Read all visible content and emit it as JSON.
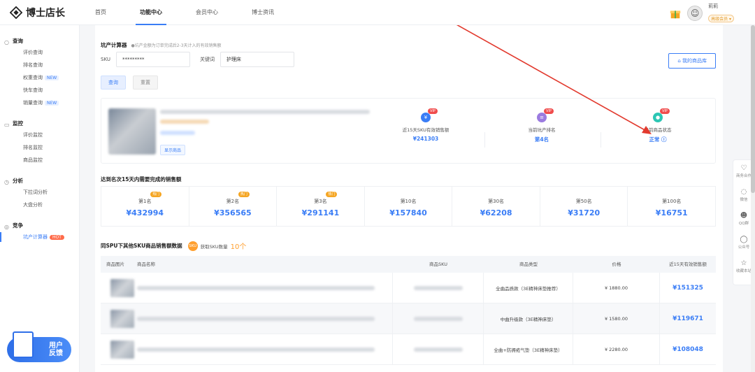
{
  "app": {
    "logo_text": "博士店长"
  },
  "nav": {
    "items": [
      "首页",
      "功能中心",
      "会员中心",
      "博士资讯"
    ],
    "active_index": 1
  },
  "user": {
    "name": "莉莉",
    "badge": "高级会员 ▾"
  },
  "sidebar": {
    "groups": [
      {
        "icon": "search-icon",
        "title": "查询",
        "items": [
          {
            "label": "评价查询"
          },
          {
            "label": "排名查询"
          },
          {
            "label": "权重查询",
            "tag": "NEW"
          },
          {
            "label": "快车查询"
          },
          {
            "label": "销量查询",
            "tag": "NEW"
          }
        ]
      },
      {
        "icon": "monitor-icon",
        "title": "监控",
        "items": [
          {
            "label": "评价监控"
          },
          {
            "label": "排名监控"
          },
          {
            "label": "商品监控"
          }
        ]
      },
      {
        "icon": "analysis-icon",
        "title": "分析",
        "items": [
          {
            "label": "下拉词分析"
          },
          {
            "label": "大盘分析"
          }
        ]
      },
      {
        "icon": "compete-icon",
        "title": "竞争",
        "items": [
          {
            "label": "坑产计算器",
            "tag": "HOT",
            "active": true
          }
        ]
      }
    ],
    "feedback": {
      "line1": "用户",
      "line2": "反馈"
    }
  },
  "calculator": {
    "title": "坑产计算器",
    "hint": "●坑产金额为订单完成后2-3天计入的有效销售额",
    "sku_label": "SKU",
    "sku_value": "*********",
    "keyword_label": "关键词",
    "keyword_value": "护理床",
    "query_button": "查询",
    "reset_button": "重置",
    "my_library_button": "我的商品库"
  },
  "product_card": {
    "show_button": "显示商品",
    "stats": [
      {
        "label": "近15天SKU有效销售额",
        "value": "¥241303",
        "color": "#3a7df6"
      },
      {
        "label": "当前坑产排名",
        "value": "第4名",
        "color": "#9b7be0"
      },
      {
        "label": "当前商品状态",
        "value": "正常 ⓘ",
        "color": "#2cc6b4"
      }
    ],
    "vip_tag": "VIP"
  },
  "rank_section": {
    "title": "达到名次15天内需要完成的销售额",
    "tag": "热门",
    "cells": [
      {
        "name": "第1名",
        "value": "¥432994",
        "tagged": true
      },
      {
        "name": "第2名",
        "value": "¥356565",
        "tagged": true
      },
      {
        "name": "第3名",
        "value": "¥291141",
        "tagged": true
      },
      {
        "name": "第10名",
        "value": "¥157840",
        "tagged": false
      },
      {
        "name": "第30名",
        "value": "¥62208",
        "tagged": false
      },
      {
        "name": "第50名",
        "value": "¥31720",
        "tagged": false
      },
      {
        "name": "第100名",
        "value": "¥16751",
        "tagged": false
      }
    ]
  },
  "sku_section": {
    "title": "同SPU下其他SKU商品销售额数据",
    "count_icon": "SKU",
    "count_label": "获取SKU数量",
    "count_value": "10个"
  },
  "table": {
    "headers": {
      "image": "商品图片",
      "name": "商品名称",
      "sku": "商品SKU",
      "type": "商品类型",
      "price": "价格",
      "sales": "近15天有效销售额"
    },
    "rows": [
      {
        "type": "全曲品质款（3E精神床垫推荐）",
        "price": "¥ 1880.00",
        "sales": "¥151325"
      },
      {
        "type": "中曲升级款（3E精神床垫）",
        "price": "¥ 1580.00",
        "sales": "¥119671"
      },
      {
        "type": "全曲+防褥疮气垫（3E精神床垫）",
        "price": "¥ 2280.00",
        "sales": "¥108048"
      }
    ]
  },
  "float_bar": {
    "items": [
      {
        "icon": "handshake-icon",
        "label": "商务合作"
      },
      {
        "icon": "wechat-icon",
        "label": "微信"
      },
      {
        "icon": "qq-icon",
        "label": "QQ群"
      },
      {
        "icon": "chat-icon",
        "label": "公众号"
      },
      {
        "icon": "star-icon",
        "label": "收藏本站"
      }
    ]
  }
}
